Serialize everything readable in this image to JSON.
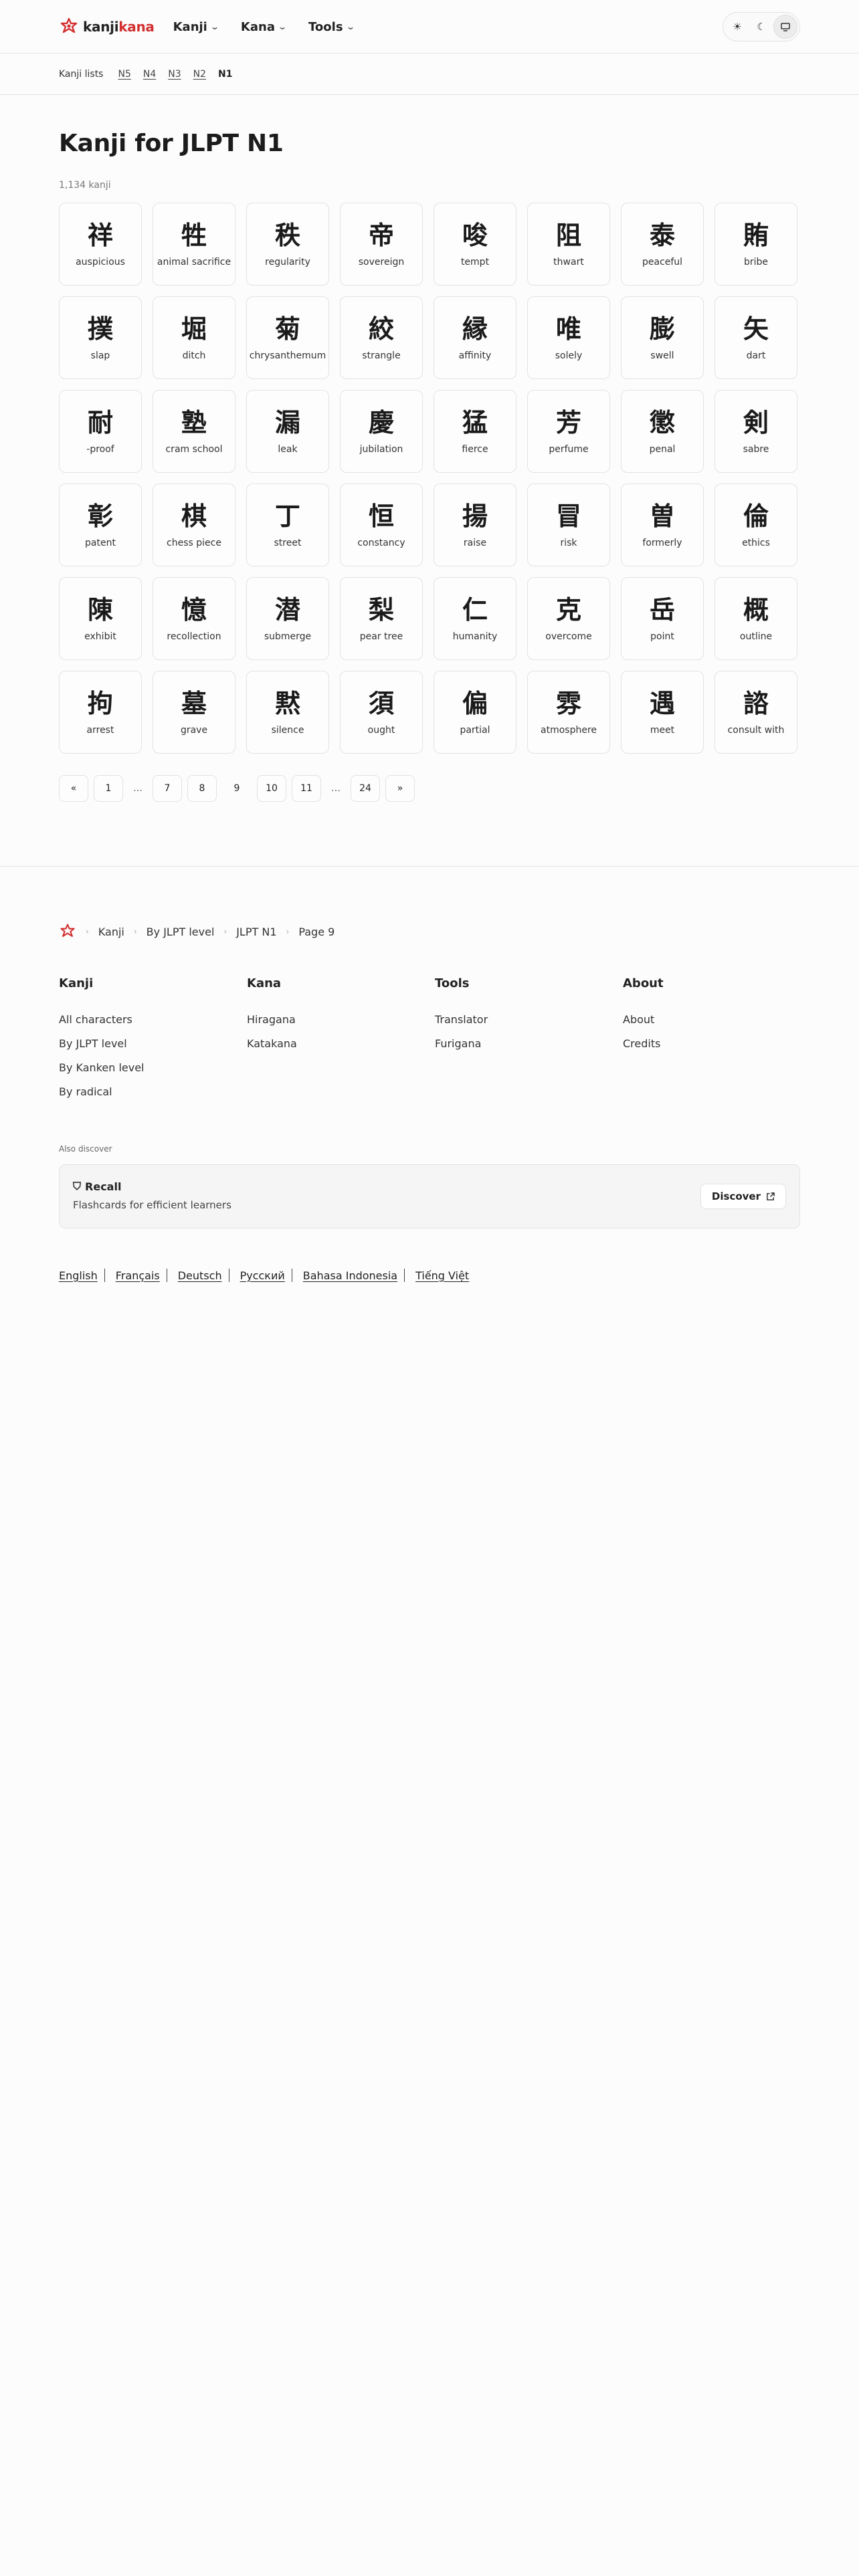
{
  "header": {
    "logo_part1": "kanji",
    "logo_part2": "kana",
    "nav": [
      {
        "label": "Kanji"
      },
      {
        "label": "Kana"
      },
      {
        "label": "Tools"
      }
    ],
    "theme": {
      "light_icon": "sun-icon",
      "dark_icon": "moon-icon",
      "system_icon": "monitor-icon",
      "active": "system"
    }
  },
  "subnav": {
    "label": "Kanji lists",
    "levels": [
      "N5",
      "N4",
      "N3",
      "N2"
    ],
    "current": "N1"
  },
  "main": {
    "title": "Kanji for JLPT N1",
    "count": "1,134 kanji",
    "kanji": [
      {
        "char": "祥",
        "meaning": "auspicious"
      },
      {
        "char": "牲",
        "meaning": "animal sacrifice"
      },
      {
        "char": "秩",
        "meaning": "regularity"
      },
      {
        "char": "帝",
        "meaning": "sovereign"
      },
      {
        "char": "唆",
        "meaning": "tempt"
      },
      {
        "char": "阻",
        "meaning": "thwart"
      },
      {
        "char": "泰",
        "meaning": "peaceful"
      },
      {
        "char": "賄",
        "meaning": "bribe"
      },
      {
        "char": "撲",
        "meaning": "slap"
      },
      {
        "char": "堀",
        "meaning": "ditch"
      },
      {
        "char": "菊",
        "meaning": "chrysanthemum"
      },
      {
        "char": "絞",
        "meaning": "strangle"
      },
      {
        "char": "縁",
        "meaning": "affinity"
      },
      {
        "char": "唯",
        "meaning": "solely"
      },
      {
        "char": "膨",
        "meaning": "swell"
      },
      {
        "char": "矢",
        "meaning": "dart"
      },
      {
        "char": "耐",
        "meaning": "-proof"
      },
      {
        "char": "塾",
        "meaning": "cram school"
      },
      {
        "char": "漏",
        "meaning": "leak"
      },
      {
        "char": "慶",
        "meaning": "jubilation"
      },
      {
        "char": "猛",
        "meaning": "fierce"
      },
      {
        "char": "芳",
        "meaning": "perfume"
      },
      {
        "char": "懲",
        "meaning": "penal"
      },
      {
        "char": "剣",
        "meaning": "sabre"
      },
      {
        "char": "彰",
        "meaning": "patent"
      },
      {
        "char": "棋",
        "meaning": "chess piece"
      },
      {
        "char": "丁",
        "meaning": "street"
      },
      {
        "char": "恒",
        "meaning": "constancy"
      },
      {
        "char": "揚",
        "meaning": "raise"
      },
      {
        "char": "冒",
        "meaning": "risk"
      },
      {
        "char": "曽",
        "meaning": "formerly"
      },
      {
        "char": "倫",
        "meaning": "ethics"
      },
      {
        "char": "陳",
        "meaning": "exhibit"
      },
      {
        "char": "憶",
        "meaning": "recollection"
      },
      {
        "char": "潜",
        "meaning": "submerge"
      },
      {
        "char": "梨",
        "meaning": "pear tree"
      },
      {
        "char": "仁",
        "meaning": "humanity"
      },
      {
        "char": "克",
        "meaning": "overcome"
      },
      {
        "char": "岳",
        "meaning": "point"
      },
      {
        "char": "概",
        "meaning": "outline"
      },
      {
        "char": "拘",
        "meaning": "arrest"
      },
      {
        "char": "墓",
        "meaning": "grave"
      },
      {
        "char": "黙",
        "meaning": "silence"
      },
      {
        "char": "須",
        "meaning": "ought"
      },
      {
        "char": "偏",
        "meaning": "partial"
      },
      {
        "char": "雰",
        "meaning": "atmosphere"
      },
      {
        "char": "遇",
        "meaning": "meet"
      },
      {
        "char": "諮",
        "meaning": "consult with"
      }
    ]
  },
  "pagination": {
    "prev": "«",
    "first": "1",
    "ellipsis": "…",
    "p7": "7",
    "p8": "8",
    "current": "9",
    "p10": "10",
    "p11": "11",
    "last": "24",
    "next": "»"
  },
  "footer": {
    "breadcrumb": [
      "Kanji",
      "By JLPT level",
      "JLPT N1",
      "Page 9"
    ],
    "columns": [
      {
        "title": "Kanji",
        "links": [
          "All characters",
          "By JLPT level",
          "By Kanken level",
          "By radical"
        ]
      },
      {
        "title": "Kana",
        "links": [
          "Hiragana",
          "Katakana"
        ]
      },
      {
        "title": "Tools",
        "links": [
          "Translator",
          "Furigana"
        ]
      },
      {
        "title": "About",
        "links": [
          "About",
          "Credits"
        ]
      }
    ],
    "also_discover": "Also discover",
    "recall": {
      "title": "Recall",
      "subtitle": "Flashcards for efficient learners",
      "button": "Discover"
    },
    "languages": [
      "English",
      "Français",
      "Deutsch",
      "Русский",
      "Bahasa Indonesia",
      "Tiếng Việt"
    ]
  },
  "colors": {
    "brand": "#d32f2f"
  }
}
